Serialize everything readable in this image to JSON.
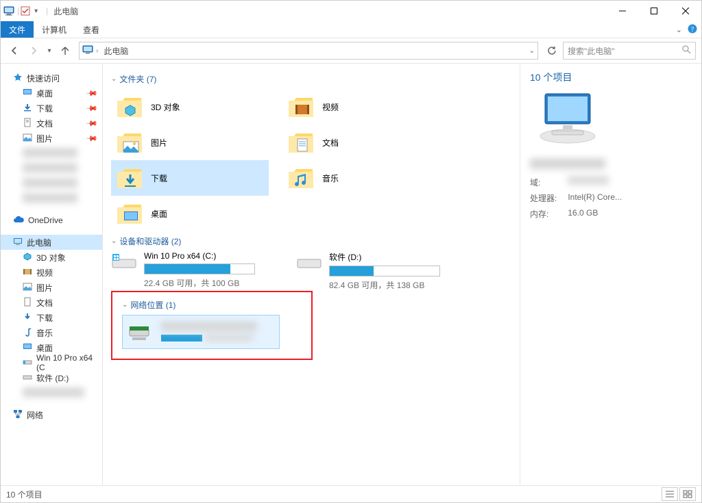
{
  "window": {
    "title": "此电脑"
  },
  "qat": {
    "chevron": true
  },
  "ribbon": {
    "tabs": {
      "file": "文件",
      "computer": "计算机",
      "view": "查看"
    }
  },
  "nav": {
    "breadcrumb_sep": "›",
    "location": "此电脑"
  },
  "search": {
    "placeholder": "搜索\"此电脑\""
  },
  "sidebar": {
    "quick_access": "快速访问",
    "qa_items": [
      {
        "label": "桌面",
        "pin": true
      },
      {
        "label": "下载",
        "pin": true
      },
      {
        "label": "文档",
        "pin": true
      },
      {
        "label": "图片",
        "pin": true
      }
    ],
    "onedrive": "OneDrive",
    "this_pc": "此电脑",
    "pc_items": [
      {
        "label": "3D 对象"
      },
      {
        "label": "视频"
      },
      {
        "label": "图片"
      },
      {
        "label": "文档"
      },
      {
        "label": "下载"
      },
      {
        "label": "音乐"
      },
      {
        "label": "桌面"
      },
      {
        "label": "Win 10 Pro x64 (C"
      },
      {
        "label": "软件 (D:)"
      }
    ],
    "network": "网络"
  },
  "groups": {
    "folders": {
      "title": "文件夹 (7)"
    },
    "drives": {
      "title": "设备和驱动器 (2)"
    },
    "network": {
      "title": "网络位置 (1)"
    }
  },
  "folders": [
    {
      "label": "3D 对象"
    },
    {
      "label": "视频"
    },
    {
      "label": "图片"
    },
    {
      "label": "文档"
    },
    {
      "label": "下载"
    },
    {
      "label": "音乐"
    },
    {
      "label": "桌面"
    }
  ],
  "drives": [
    {
      "label": "Win 10 Pro x64 (C:)",
      "sub": "22.4 GB 可用，共 100 GB",
      "fill": 78
    },
    {
      "label": "软件 (D:)",
      "sub": "82.4 GB 可用，共 138 GB",
      "fill": 40
    }
  ],
  "details": {
    "title": "10 个项目",
    "rows": {
      "domain": {
        "k": "域:",
        "v": ""
      },
      "cpu": {
        "k": "处理器:",
        "v": "Intel(R) Core..."
      },
      "mem": {
        "k": "内存:",
        "v": "16.0 GB"
      }
    }
  },
  "status": {
    "text": "10 个项目"
  }
}
